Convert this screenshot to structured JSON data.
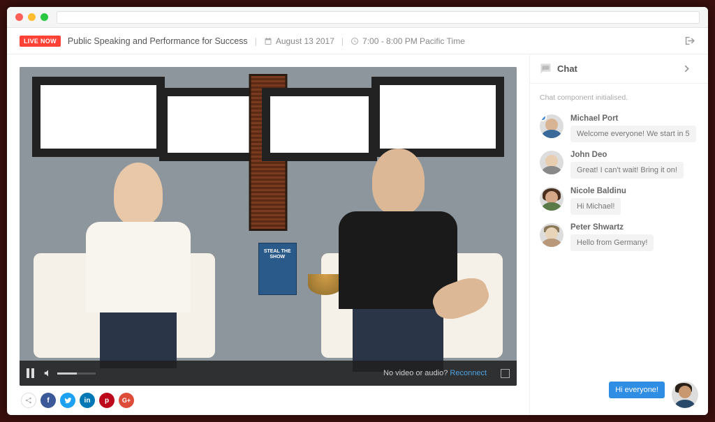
{
  "header": {
    "live_badge": "LIVE NOW",
    "title": "Public Speaking and Performance for Success",
    "date": "August 13 2017",
    "time": "7:00 - 8:00 PM Pacific Time"
  },
  "video": {
    "book_title": "STEAL THE SHOW",
    "reconnect_prompt": "No video or audio?",
    "reconnect_link": "Reconnect"
  },
  "share": {
    "facebook": "f",
    "twitter": "t",
    "linkedin": "in",
    "pinterest": "p",
    "google": "G+"
  },
  "chat": {
    "title": "Chat",
    "init_text": "Chat component initialised.",
    "messages": [
      {
        "name": "Michael Port",
        "text": "Welcome everyone! We start in 5"
      },
      {
        "name": "John Deo",
        "text": "Great! I can't wait! Bring it on!"
      },
      {
        "name": "Nicole Baldinu",
        "text": "Hi Michael!"
      },
      {
        "name": "Peter Shwartz",
        "text": "Hello from Germany!"
      }
    ],
    "outgoing": {
      "text": "Hi everyone!"
    }
  }
}
